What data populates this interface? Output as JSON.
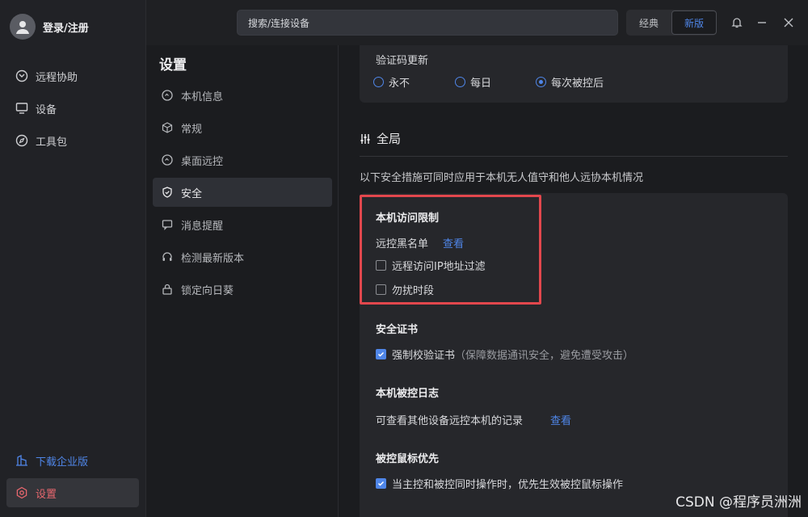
{
  "user": {
    "label": "登录/注册"
  },
  "leftnav": {
    "items": [
      {
        "label": "远程协助",
        "icon": "remote-assist-icon"
      },
      {
        "label": "设备",
        "icon": "monitor-icon"
      },
      {
        "label": "工具包",
        "icon": "compass-icon"
      }
    ],
    "enterprise": "下载企业版",
    "settings": "设置"
  },
  "topbar": {
    "search_placeholder": "搜索/连接设备",
    "mode_classic": "经典",
    "mode_new": "新版"
  },
  "subnav": {
    "title": "设置",
    "items": [
      {
        "label": "本机信息"
      },
      {
        "label": "常规"
      },
      {
        "label": "桌面远控"
      },
      {
        "label": "安全"
      },
      {
        "label": "消息提醒"
      },
      {
        "label": "检测最新版本"
      },
      {
        "label": "锁定向日葵"
      }
    ]
  },
  "main": {
    "verify_update": {
      "title": "验证码更新",
      "options": [
        "永不",
        "每日",
        "每次被控后"
      ],
      "selected": "每次被控后"
    },
    "global": {
      "title": "全局",
      "description": "以下安全措施可同时应用于本机无人值守和他人远协本机情况"
    },
    "access_limit": {
      "title": "本机访问限制",
      "blacklist_label": "远控黑名单",
      "blacklist_link": "查看",
      "ip_filter": "远程访问IP地址过滤",
      "dnd": "勿扰时段"
    },
    "certificate": {
      "title": "安全证书",
      "force_verify": "强制校验证书",
      "force_verify_note": "（保障数据通讯安全，避免遭受攻击）"
    },
    "log": {
      "title": "本机被控日志",
      "desc": "可查看其他设备远控本机的记录",
      "link": "查看"
    },
    "mouse": {
      "title": "被控鼠标优先",
      "option": "当主控和被控同时操作时，优先生效被控鼠标操作"
    }
  },
  "watermark": "CSDN @程序员洲洲",
  "colors": {
    "accent": "#4f86e8",
    "danger": "#e8676e",
    "highlight": "#e2474d"
  }
}
